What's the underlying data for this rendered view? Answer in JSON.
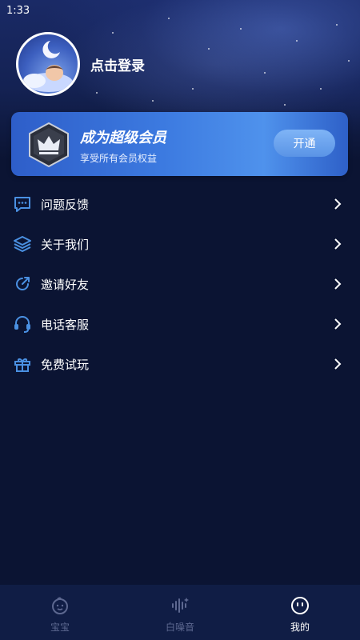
{
  "status_bar": {
    "time": "1:33"
  },
  "profile": {
    "login_text": "点击登录",
    "avatar_icon": "moon-sleeping-baby-icon"
  },
  "vip": {
    "title": "成为超级会员",
    "subtitle": "享受所有会员权益",
    "button_label": "开通",
    "badge_icon": "crown-icon"
  },
  "menu": {
    "items": [
      {
        "label": "问题反馈",
        "icon": "message-icon"
      },
      {
        "label": "关于我们",
        "icon": "layers-icon"
      },
      {
        "label": "邀请好友",
        "icon": "share-icon"
      },
      {
        "label": "电话客服",
        "icon": "headset-icon"
      },
      {
        "label": "免费试玩",
        "icon": "gift-icon"
      }
    ]
  },
  "tabbar": {
    "tabs": [
      {
        "label": "宝宝",
        "icon": "baby-face-icon",
        "active": false
      },
      {
        "label": "白噪音",
        "icon": "sound-wave-icon",
        "active": false
      },
      {
        "label": "我的",
        "icon": "smiley-icon",
        "active": true
      }
    ]
  },
  "colors": {
    "background": "#0b1433",
    "accent": "#3c7ae0",
    "icon_blue": "#4a90e2",
    "tab_inactive": "#5d6890"
  }
}
